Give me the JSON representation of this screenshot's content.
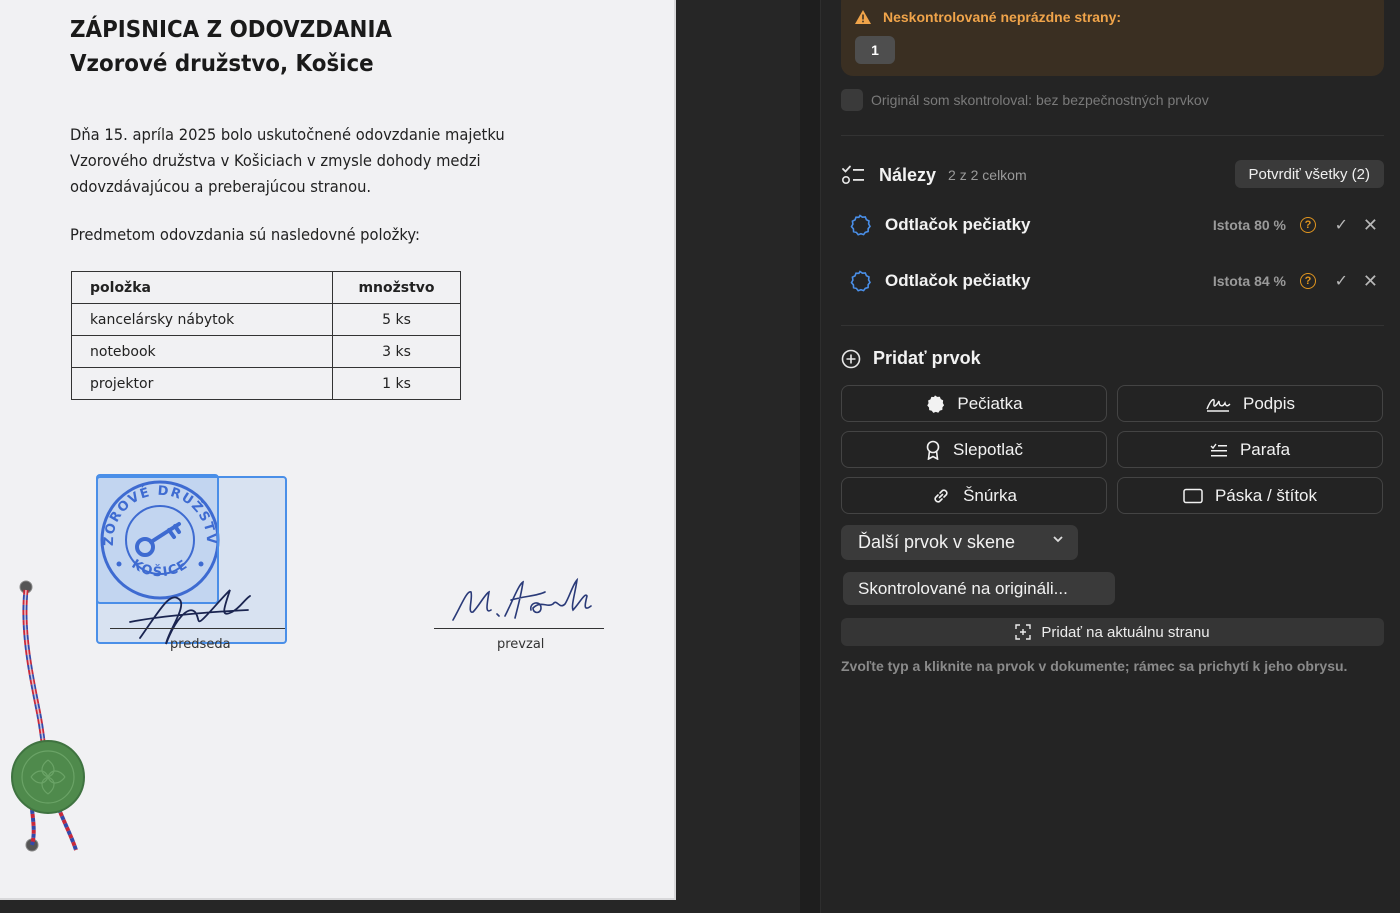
{
  "document": {
    "title": "ZÁPISNICA Z ODOVZDANIA",
    "subtitle": "Vzorové družstvo, Košice",
    "paragraph1": "Dňa 15. apríla 2025 bolo uskutočnené odovzdanie majetku Vzorového družstva v Košiciach v zmysle dohody medzi odovzdávajúcou a preberajúcou stranou.",
    "paragraph2": "Predmetom odovzdania sú nasledovné položky:",
    "table": {
      "headers": [
        "položka",
        "množstvo"
      ],
      "rows": [
        [
          "kancelársky nábytok",
          "5 ks"
        ],
        [
          "notebook",
          "3 ks"
        ],
        [
          "projektor",
          "1 ks"
        ]
      ]
    },
    "stamp": {
      "top_text": "VZOROVÉ DRUŽSTVO",
      "bottom_text": "KOŠICE",
      "color": "#3a5fc8"
    },
    "signatures": [
      {
        "label": "predseda"
      },
      {
        "label": "prevzal",
        "handwriting": "M. Horvath"
      }
    ],
    "seal_color": "#4f8a4c"
  },
  "panel": {
    "warning": {
      "icon": "warning-triangle-icon",
      "text": "Neskontrolované neprázdne strany:",
      "pages": [
        "1"
      ],
      "color": "#f0a44a"
    },
    "original_check_label": "Originál som skontroloval: bez bezpečnostných prvkov",
    "findings": {
      "title": "Nálezy",
      "count": "2 z 2 celkom",
      "confirm_all": "Potvrdiť všetky (2)",
      "items": [
        {
          "name": "Odtlačok pečiatky",
          "confidence": "Istota 80 %",
          "help": "?"
        },
        {
          "name": "Odtlačok pečiatky",
          "confidence": "Istota 84 %",
          "help": "?"
        }
      ]
    },
    "add": {
      "title": "Pridať prvok",
      "buttons": [
        {
          "label": "Pečiatka",
          "icon": "stamp-icon"
        },
        {
          "label": "Podpis",
          "icon": "signature-icon"
        },
        {
          "label": "Slepotlač",
          "icon": "ribbon-icon"
        },
        {
          "label": "Parafa",
          "icon": "initials-icon"
        },
        {
          "label": "Šnúrka",
          "icon": "link-icon"
        },
        {
          "label": "Páska / štítok",
          "icon": "rectangle-icon"
        }
      ],
      "dropdown": "Ďalší prvok v skene",
      "checked_original": "Skontrolované na origináli...",
      "add_to_page": "Pridať na aktuálnu stranu",
      "hint": "Zvoľte typ a kliknite na prvok v dokumente; rámec sa prichytí k jeho obrysu."
    }
  }
}
